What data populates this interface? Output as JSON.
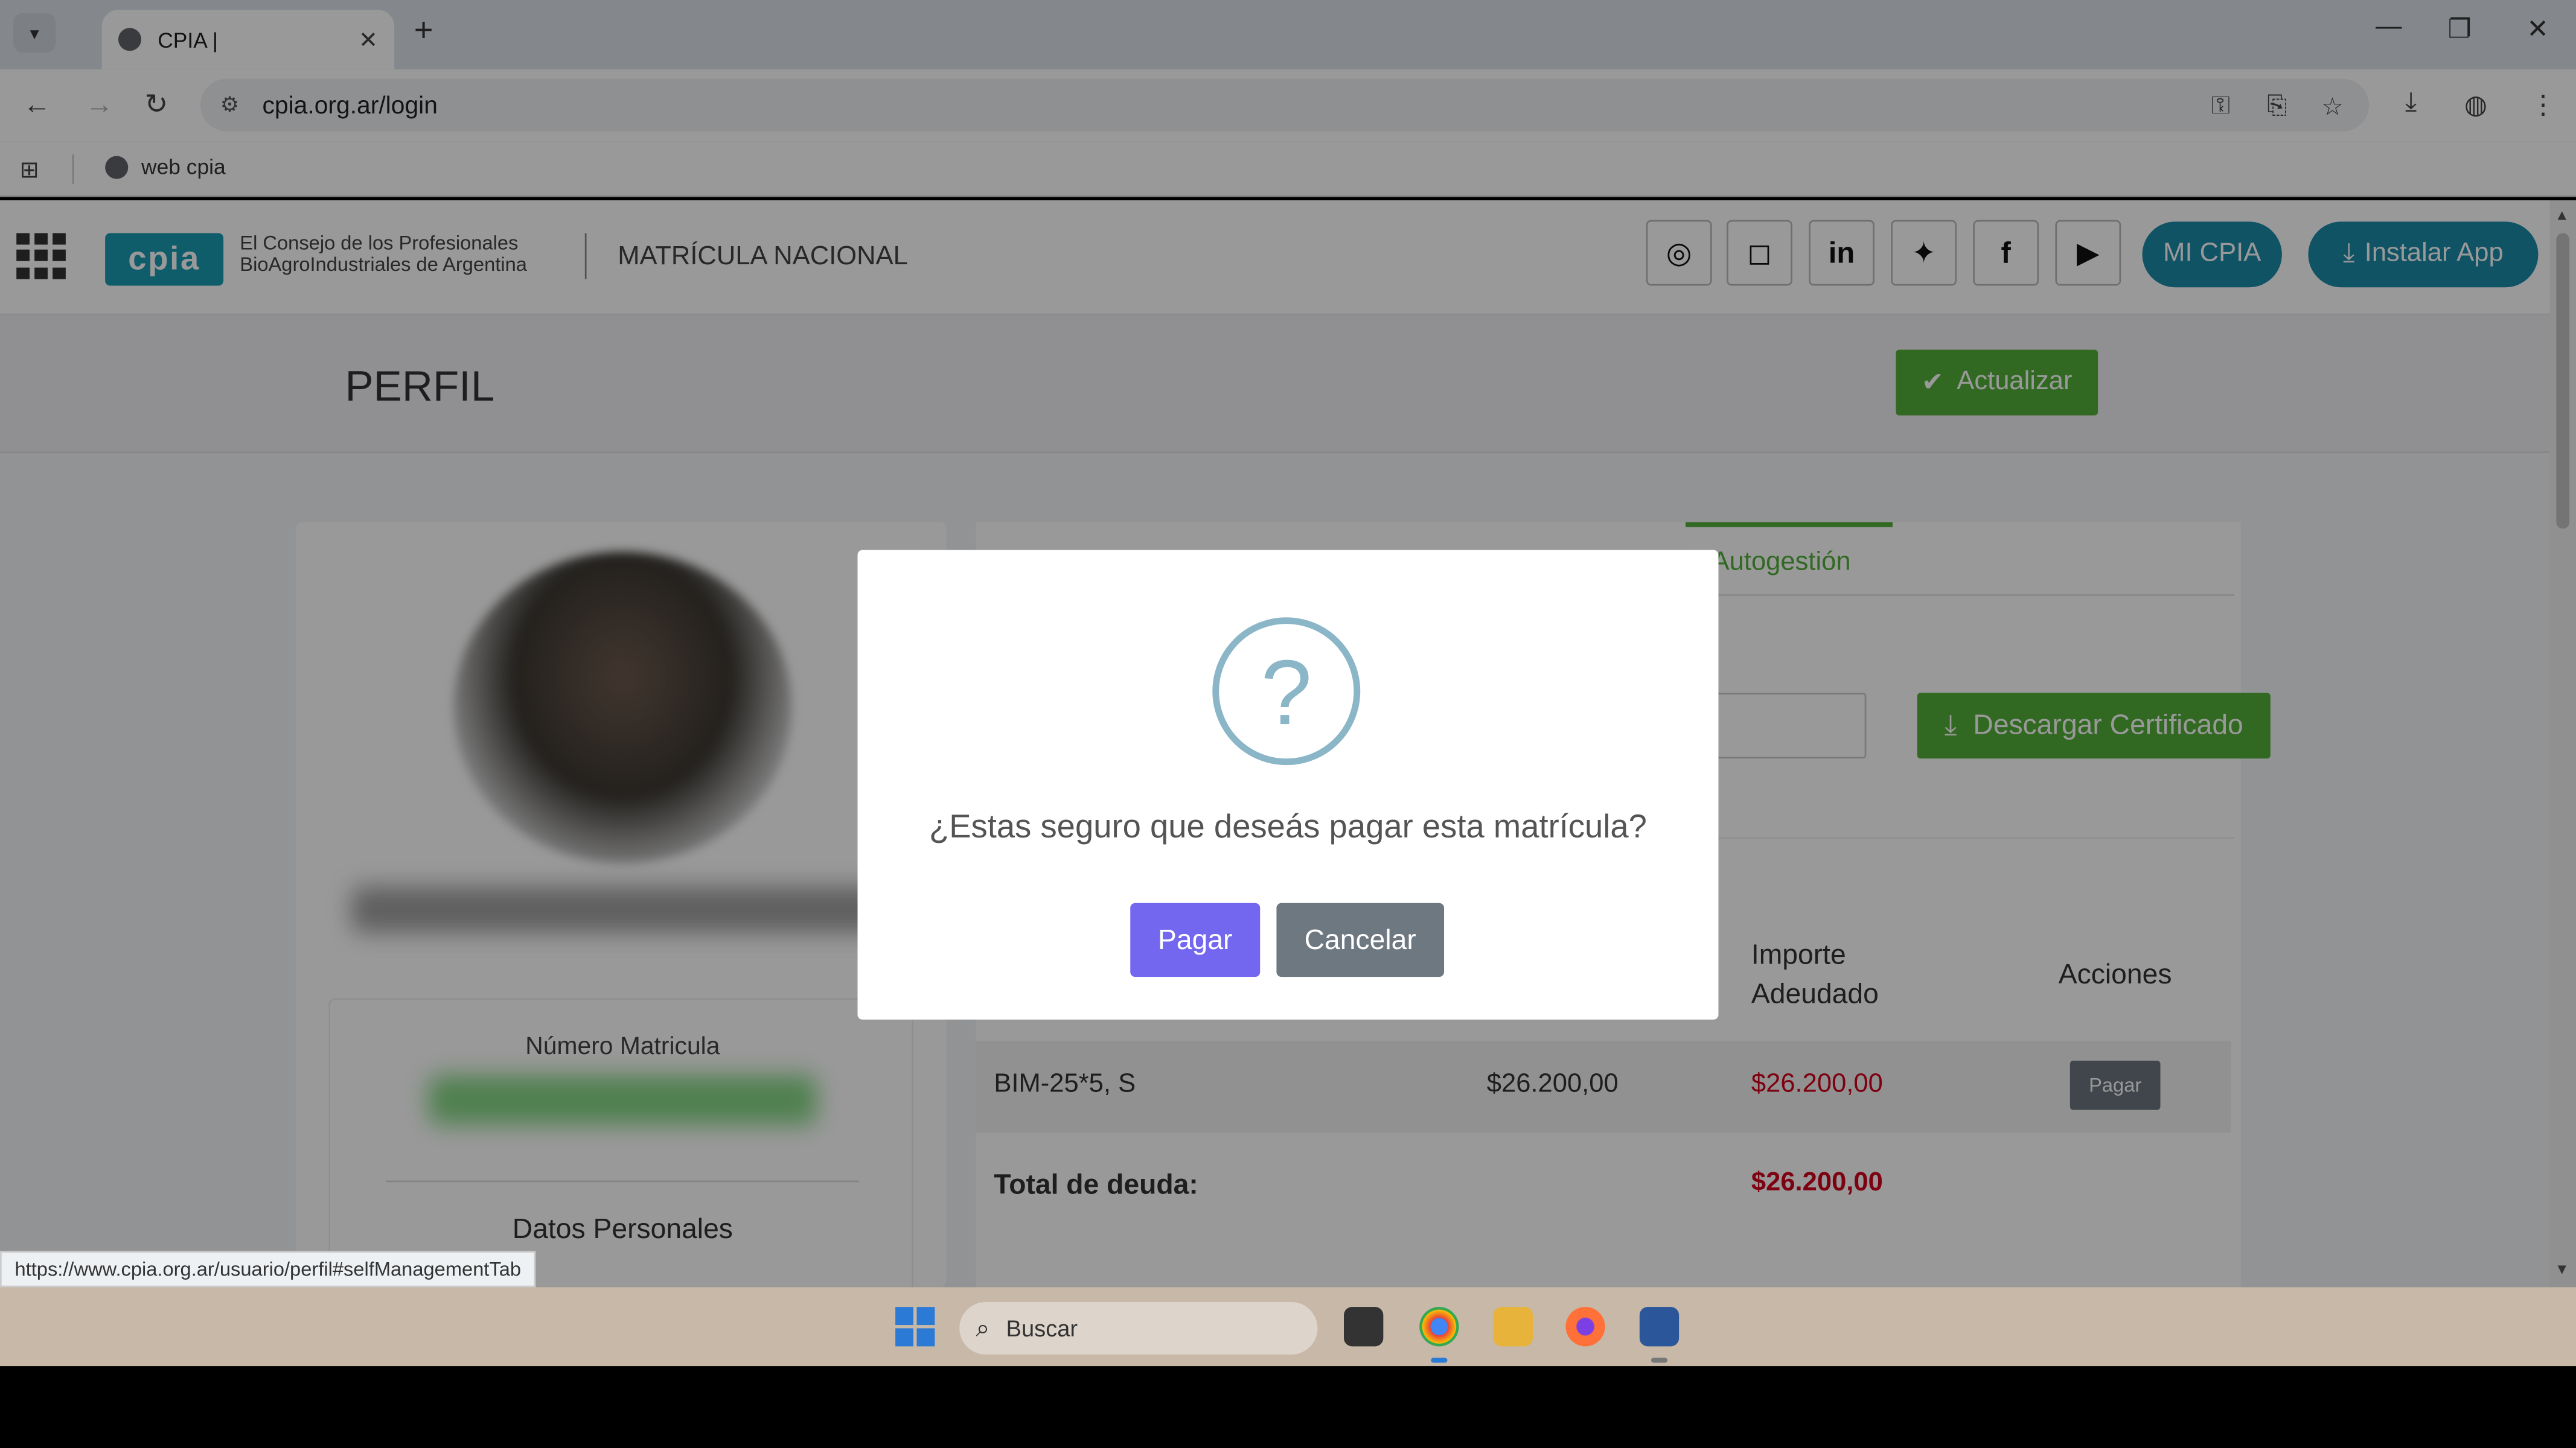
{
  "browser": {
    "tab_title": "CPIA |",
    "url": "cpia.org.ar/login",
    "bookmark": "web cpia",
    "status_url": "https://www.cpia.org.ar/usuario/perfil#selfManagementTab"
  },
  "header": {
    "logo_text": "cpia",
    "org_line1": "El Consejo de los Profesionales",
    "org_line2": "BioAgroIndustriales de Argentina",
    "section_title": "MATRÍCULA NACIONAL",
    "social_icons": [
      "whatsapp-icon",
      "instagram-icon",
      "linkedin-icon",
      "twitter-icon",
      "facebook-icon",
      "youtube-icon"
    ],
    "mi_cpia": "MI CPIA",
    "install_app": "Instalar App"
  },
  "profile": {
    "title": "PERFIL",
    "update_button": "Actualizar",
    "matricula_label": "Número Matricula",
    "datos_label": "Datos Personales"
  },
  "autogestion": {
    "tab_label": "Autogestión",
    "cert_button": "Descargar Certificado",
    "table": {
      "col_importe": "Importe Adeudado",
      "col_acciones": "Acciones",
      "row": {
        "concepto": "BIM-25*5, S",
        "importe": "$26.200,00",
        "adeudado": "$26.200,00",
        "action": "Pagar"
      },
      "total_label": "Total de deuda:",
      "total_value": "$26.200,00"
    }
  },
  "modal": {
    "icon": "question-icon",
    "message": "¿Estas seguro que deseás pagar esta matrícula?",
    "confirm": "Pagar",
    "cancel": "Cancelar"
  },
  "taskbar": {
    "search_placeholder": "Buscar"
  },
  "colors": {
    "accent_green": "#52b03a",
    "teal": "#1a8aa8",
    "modal_confirm": "#7367f0",
    "modal_cancel": "#6e7881",
    "debt_red": "#d0021b"
  }
}
